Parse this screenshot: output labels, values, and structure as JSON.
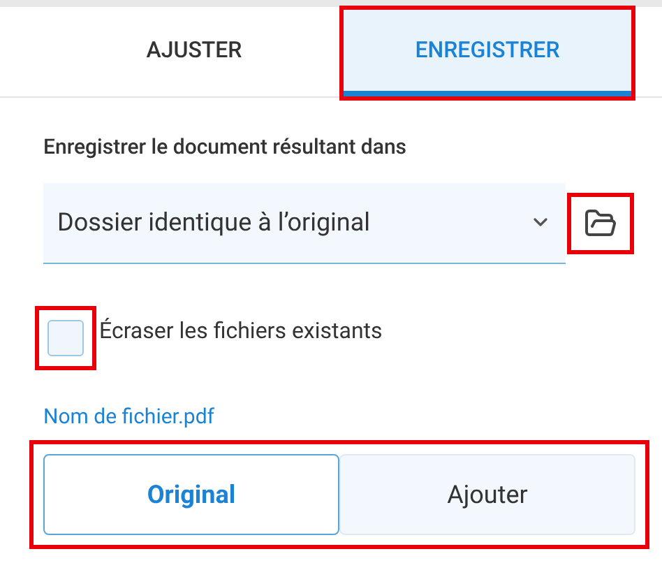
{
  "tabs": [
    {
      "label": "AJUSTER",
      "selected": false,
      "highlighted": false
    },
    {
      "label": "ENREGISTRER",
      "selected": true,
      "highlighted": true
    }
  ],
  "destination": {
    "label": "Enregistrer le document résultant dans",
    "value": "Dossier identique à l’original",
    "browse_highlighted": true
  },
  "overwrite": {
    "label": "Écraser les fichiers existants",
    "checked": false,
    "highlighted": true
  },
  "file_name": "Nom de fichier.pdf",
  "mode": {
    "highlighted": true,
    "options": [
      {
        "label": "Original",
        "selected": true
      },
      {
        "label": "Ajouter",
        "selected": false
      }
    ]
  }
}
